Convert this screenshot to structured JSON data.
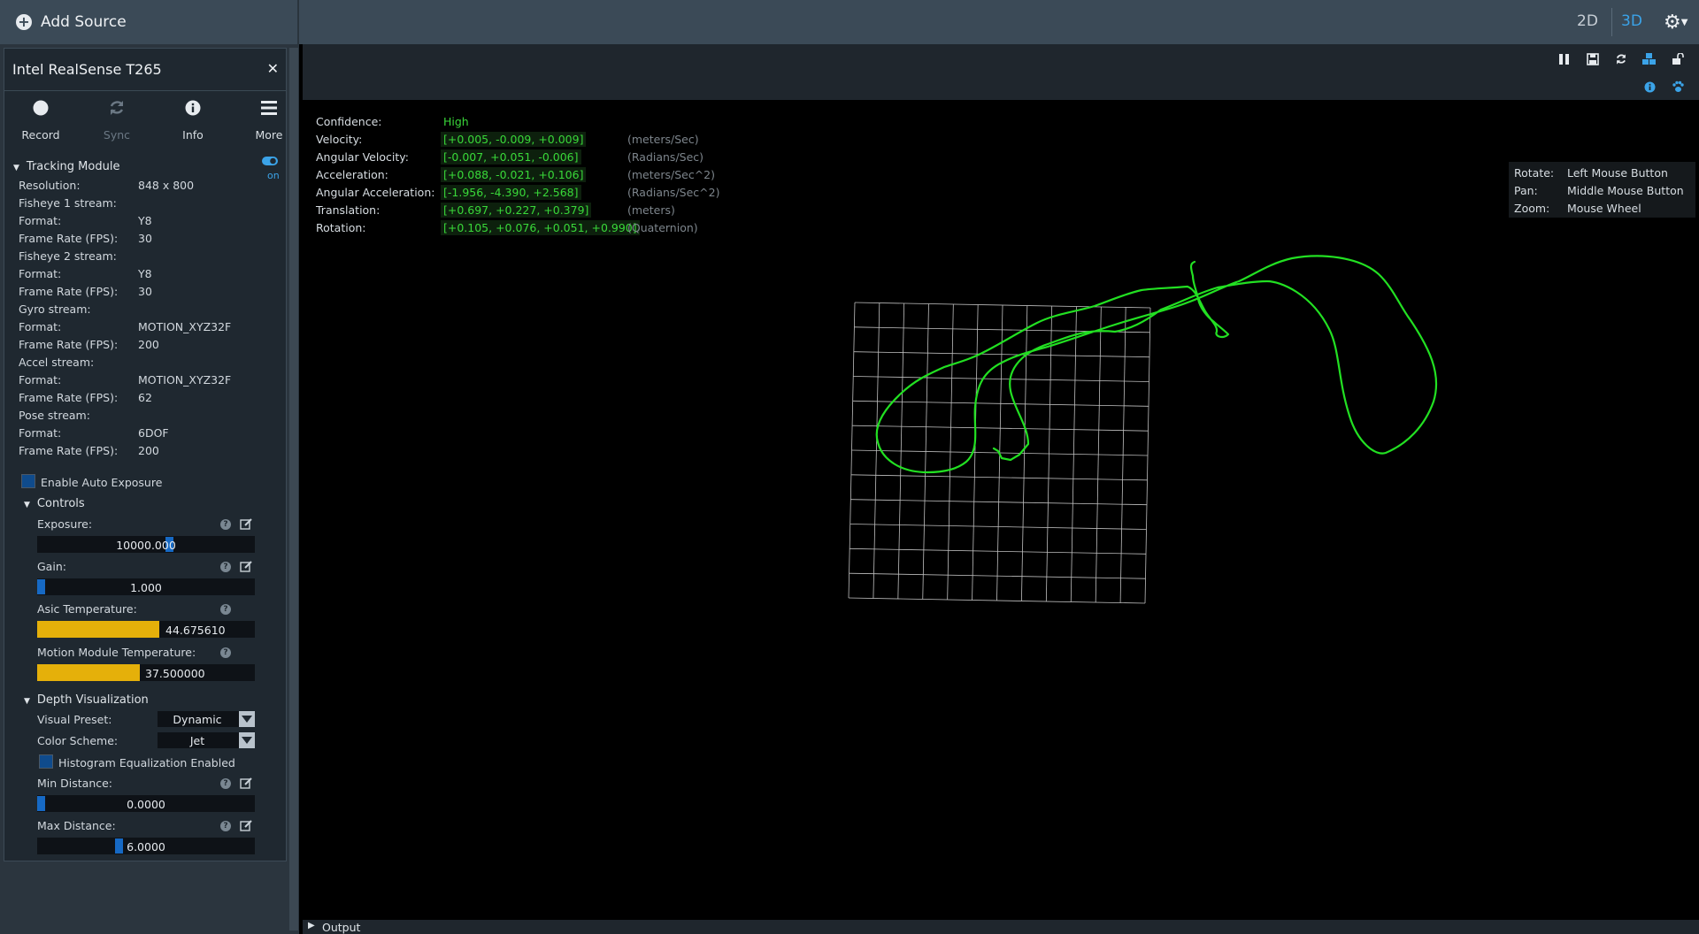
{
  "topbar": {
    "add_source_label": "Add Source",
    "view_2d": "2D",
    "view_3d": "3D",
    "active_view": "3D",
    "accent_color": "#3ba3e8"
  },
  "device": {
    "name": "Intel RealSense T265",
    "buttons": [
      {
        "label": "Record",
        "icon": "record-icon",
        "enabled": true
      },
      {
        "label": "Sync",
        "icon": "sync-icon",
        "enabled": false
      },
      {
        "label": "Info",
        "icon": "info-icon",
        "enabled": true
      },
      {
        "label": "More",
        "icon": "menu-icon",
        "enabled": true
      }
    ],
    "module": {
      "title": "Tracking Module",
      "toggle_label": "on",
      "rows": [
        {
          "k": "Resolution:",
          "v": "848 x 800"
        },
        {
          "k": "Fisheye 1 stream:",
          "v": ""
        },
        {
          "k": "Format:",
          "v": "Y8"
        },
        {
          "k": "Frame Rate (FPS):",
          "v": "30"
        },
        {
          "k": "Fisheye 2 stream:",
          "v": ""
        },
        {
          "k": "Format:",
          "v": "Y8"
        },
        {
          "k": "Frame Rate (FPS):",
          "v": "30"
        },
        {
          "k": "Gyro stream:",
          "v": ""
        },
        {
          "k": "Format:",
          "v": "MOTION_XYZ32F"
        },
        {
          "k": "Frame Rate (FPS):",
          "v": "200"
        },
        {
          "k": "Accel stream:",
          "v": ""
        },
        {
          "k": "Format:",
          "v": "MOTION_XYZ32F"
        },
        {
          "k": "Frame Rate (FPS):",
          "v": "62"
        },
        {
          "k": "Pose stream:",
          "v": ""
        },
        {
          "k": "Format:",
          "v": "6DOF"
        },
        {
          "k": "Frame Rate (FPS):",
          "v": "200"
        }
      ],
      "auto_exposure_label": "Enable Auto Exposure",
      "controls": {
        "title": "Controls",
        "exposure": {
          "label": "Exposure:",
          "value": "10000.000",
          "fraction": 0.61
        },
        "gain": {
          "label": "Gain:",
          "value": "1.000",
          "fraction": 0.0
        },
        "asic_temp": {
          "label": "Asic Temperature:",
          "value": "44.675610",
          "fraction": 0.56
        },
        "motion_temp": {
          "label": "Motion Module Temperature:",
          "value": "37.500000",
          "fraction": 0.47
        }
      },
      "depth_vis": {
        "title": "Depth Visualization",
        "visual_preset": {
          "label": "Visual Preset:",
          "value": "Dynamic"
        },
        "color_scheme": {
          "label": "Color Scheme:",
          "value": "Jet"
        },
        "histogram_label": "Histogram Equalization Enabled",
        "min_distance": {
          "label": "Min Distance:",
          "value": "0.0000",
          "fraction": 0.0
        },
        "max_distance": {
          "label": "Max Distance:",
          "value": "6.0000",
          "fraction": 0.37
        }
      }
    }
  },
  "pose": [
    {
      "k": "Confidence:",
      "v": "High",
      "u": ""
    },
    {
      "k": "Velocity:",
      "v": "[+0.005, -0.009, +0.009]",
      "u": "(meters/Sec)"
    },
    {
      "k": "Angular Velocity:",
      "v": "[-0.007, +0.051, -0.006]",
      "u": "(Radians/Sec)"
    },
    {
      "k": "Acceleration:",
      "v": "[+0.088, -0.021, +0.106]",
      "u": "(meters/Sec^2)"
    },
    {
      "k": "Angular Acceleration:",
      "v": "[-1.956, -4.390, +2.568]",
      "u": "(Radians/Sec^2)"
    },
    {
      "k": "Translation:",
      "v": "[+0.697, +0.227, +0.379]",
      "u": "(meters)"
    },
    {
      "k": "Rotation:",
      "v": "[+0.105, +0.076, +0.051, +0.990]",
      "u": "(Quaternion)"
    }
  ],
  "controls_help": [
    {
      "k": "Rotate:",
      "v": "Left Mouse Button"
    },
    {
      "k": "Pan:",
      "v": "Middle Mouse Button"
    },
    {
      "k": "Zoom:",
      "v": "Mouse Wheel"
    }
  ],
  "output": {
    "label": "Output"
  },
  "colors": {
    "trajectory": "#22e022",
    "temperature_fill": "#e5b00a",
    "slider_grab": "#1669c4"
  }
}
